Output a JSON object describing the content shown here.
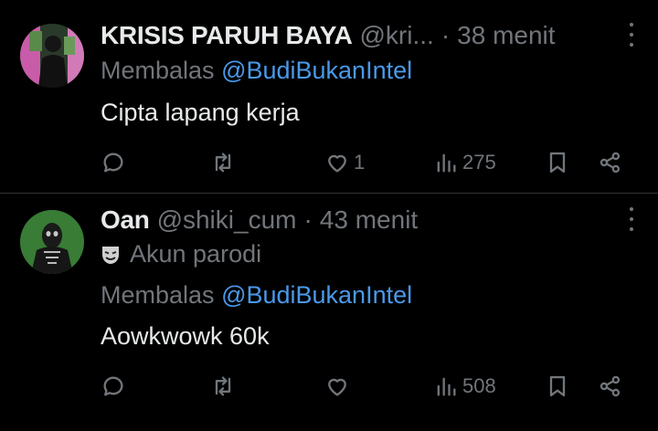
{
  "tweets": [
    {
      "display_name": "KRISIS PARUH BAYA",
      "handle": "@kri...",
      "separator": "·",
      "time": "38 menit",
      "reply_prefix": "Membalas",
      "reply_to": "@BudiBukanIntel",
      "text": "Cipta lapang kerja",
      "likes": "1",
      "views": "275",
      "avatar_color": "#c85ca8"
    },
    {
      "display_name": "Oan",
      "handle": "@shiki_cum",
      "separator": "·",
      "time": "43 menit",
      "label": "Akun parodi",
      "reply_prefix": "Membalas",
      "reply_to": "@BudiBukanIntel",
      "text": "Aowkwowk 60k",
      "likes": "",
      "views": "508",
      "avatar_color": "#3f8a3a"
    }
  ],
  "colors": {
    "background": "#000000",
    "primary_text": "#e7e9ea",
    "secondary_text": "#71767b",
    "link": "#4a99e9",
    "divider": "#2f3336"
  },
  "icons": [
    "reply-icon",
    "retweet-icon",
    "like-icon",
    "views-icon",
    "bookmark-icon",
    "share-icon",
    "more-icon",
    "parody-mask-icon"
  ]
}
